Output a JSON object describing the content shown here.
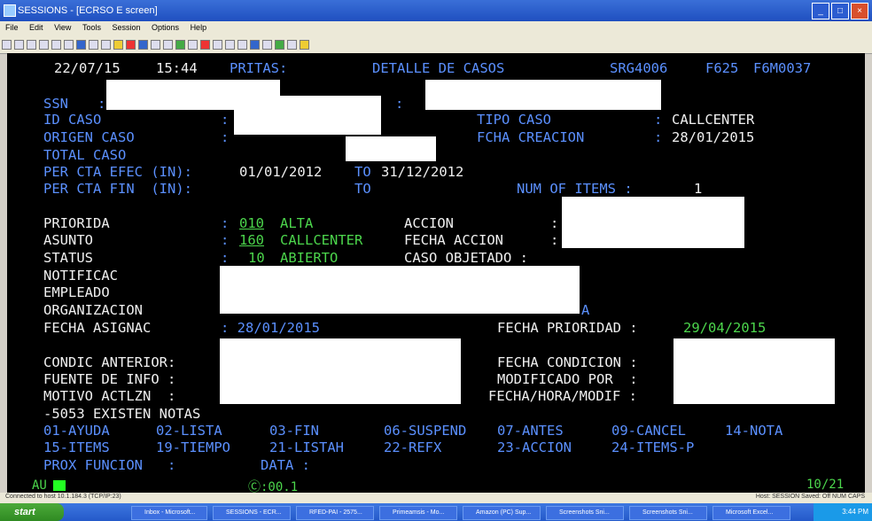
{
  "window": {
    "title": "SESSIONS - [ECRSO E screen]",
    "menu": [
      "File",
      "Edit",
      "View",
      "Tools",
      "Session",
      "Options",
      "Help"
    ]
  },
  "terminal": {
    "header": {
      "date": "22/07/15",
      "time": "15:44",
      "pritas": "PRITAS:",
      "screen_title": "DETALLE DE CASOS",
      "program": "SRG4006",
      "code1": "F625",
      "code2": "F6M0037"
    },
    "ssn_label": "SSN",
    "ssn_sep": ":",
    "ssn_sep2": ":",
    "id_caso_label": "ID CASO",
    "colon": ":",
    "origen_caso_label": "ORIGEN CASO",
    "total_caso_label": "TOTAL CASO",
    "tipo_caso_label": "TIPO CASO",
    "tipo_caso_value": "CALLCENTER",
    "fcha_creacion_label": "FCHA CREACION",
    "fcha_creacion_value": "28/01/2015",
    "per_cta_efec_label": "PER CTA EFEC (IN):",
    "per_cta_efec_from": "01/01/2012",
    "to_label": "TO",
    "per_cta_efec_to": "31/12/2012",
    "per_cta_fin_label": "PER CTA FIN  (IN):",
    "num_items_label": "NUM OF ITEMS :",
    "num_items_value": "1",
    "prioridad_label": "PRIORIDA",
    "prioridad_code": "010",
    "prioridad_text": "ALTA",
    "asunto_label": "ASUNTO",
    "asunto_code": "160",
    "asunto_text": "CALLCENTER",
    "status_label": "STATUS",
    "status_code": "10",
    "status_text": "ABIERTO",
    "accion_label": "ACCION",
    "fecha_accion_label": "FECHA ACCION",
    "caso_objetado_label": "CASO OBJETADO :",
    "notificac_label": "NOTIFICAC",
    "empleado_label": "EMPLEADO",
    "organizacion_label": "ORGANIZACION",
    "organizacion_tail": "A",
    "fecha_asignac_label": "FECHA ASIGNAC",
    "fecha_asignac_value": ": 28/01/2015",
    "fecha_prioridad_label": "FECHA PRIORIDAD :",
    "fecha_prioridad_value": "29/04/2015",
    "condic_anterior_label": "CONDIC ANTERIOR:",
    "fuente_info_label": "FUENTE DE INFO :",
    "motivo_label": "MOTIVO ACTLZN  :",
    "fecha_condicion_label": "FECHA CONDICION :",
    "modificado_por_label": "MODIFICADO POR  :",
    "fecha_hora_modif_label": "FECHA/HORA/MODIF :",
    "notas_msg": "-5053 EXISTEN NOTAS",
    "fkeys_row1": [
      "01-AYUDA",
      "02-LISTA",
      "03-FIN",
      "06-SUSPEND",
      "07-ANTES",
      "09-CANCEL",
      "14-NOTA"
    ],
    "fkeys_row2": [
      "15-ITEMS",
      "19-TIEMPO",
      "21-LISTAH",
      "22-REFX",
      "23-ACCION",
      "24-ITEMS-P"
    ],
    "prox_funcion_label": "PROX FUNCION   :",
    "data_label": "DATA :"
  },
  "oia": {
    "mode": "AU",
    "elapsed": "Ⓒ:00.1",
    "cursor_pos": "10/21"
  },
  "statusbar": {
    "left": "Connected to host 10.1.184.3 (TCP/IP:23)",
    "right": "Host: SESSION  Saved: Off    NUM    CAPS"
  },
  "taskbar": {
    "start_label": "start",
    "tasks": [
      "Inbox - Microsoft...",
      "SESSIONS - ECR...",
      "RFED-PAI - 2575...",
      "Primeamsis - Mo...",
      "Amazon (PC) Sup...",
      "Screenshots Sni...",
      "Screenshots Sni...",
      "Microsoft Excel..."
    ],
    "clock": "3:44 PM"
  },
  "colors": {
    "label_blue": "#5b90ff",
    "value_white": "#f0f0f0",
    "code_green": "#4cd64c",
    "screen_bg": "#000000"
  }
}
